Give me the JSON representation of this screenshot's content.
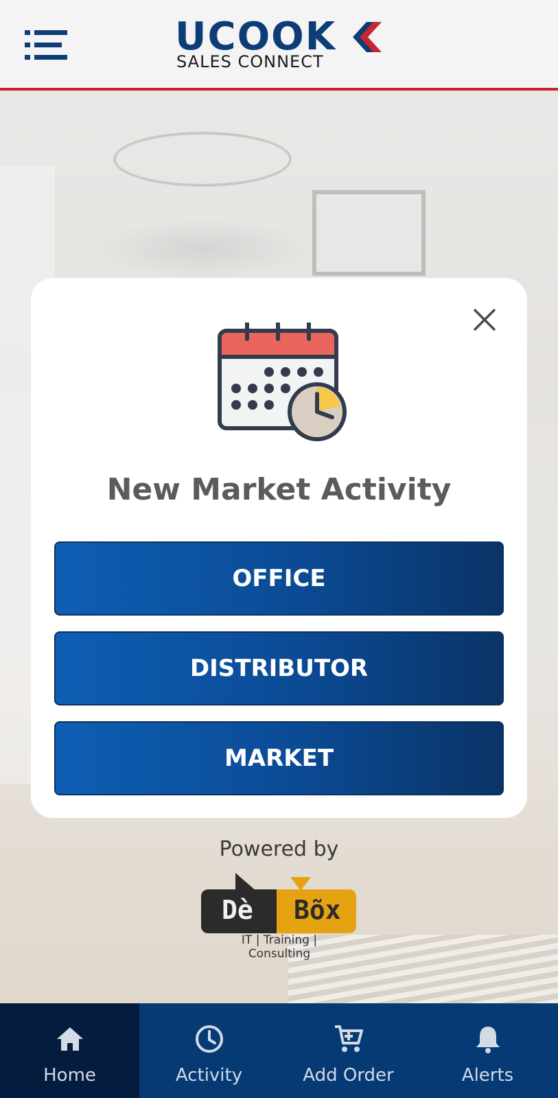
{
  "header": {
    "logo_word": "UCOOK",
    "logo_sub": "SALES CONNECT",
    "menu_icon": "hamburger-menu-icon",
    "accent_color": "#c8262e",
    "brand_color": "#0d3c77"
  },
  "modal": {
    "icon": "calendar-clock-icon",
    "close_icon": "close-icon",
    "title": "New Market Activity",
    "options": [
      {
        "label": "OFFICE"
      },
      {
        "label": "DISTRIBUTOR"
      },
      {
        "label": "MARKET"
      }
    ]
  },
  "footer": {
    "powered_by": "Powered by",
    "brand_left": "Dè",
    "brand_right": "Bõx",
    "tagline": "IT | Training | Consulting"
  },
  "nav": {
    "items": [
      {
        "label": "Home",
        "icon": "home-icon",
        "active": true
      },
      {
        "label": "Activity",
        "icon": "clock-icon",
        "active": false
      },
      {
        "label": "Add Order",
        "icon": "cart-icon",
        "active": false
      },
      {
        "label": "Alerts",
        "icon": "bell-icon",
        "active": false
      }
    ],
    "bg_color": "#053a75",
    "active_color": "#041d3f"
  }
}
